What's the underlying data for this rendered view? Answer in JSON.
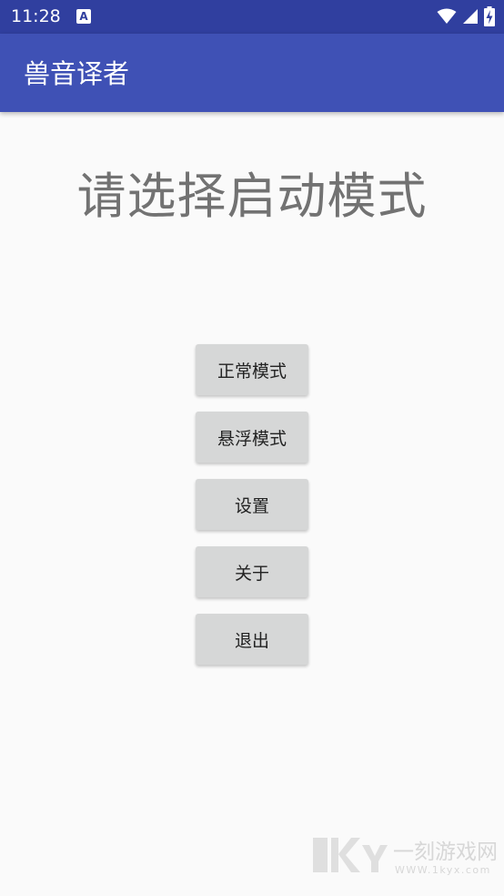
{
  "status_bar": {
    "time": "11:28",
    "notification_icon": "A",
    "icons": [
      "wifi-icon",
      "signal-icon",
      "battery-charging-icon"
    ]
  },
  "app_bar": {
    "title": "兽音译者"
  },
  "main": {
    "prompt": "请选择启动模式",
    "buttons": [
      {
        "label": "正常模式"
      },
      {
        "label": "悬浮模式"
      },
      {
        "label": "设置"
      },
      {
        "label": "关于"
      },
      {
        "label": "退出"
      }
    ]
  },
  "watermark": {
    "logo_text": "1KYX",
    "site_name": "一刻游戏网",
    "url": "WWW.1kyx.com"
  },
  "colors": {
    "status_bar": "#303f9f",
    "app_bar": "#3f51b5",
    "background": "#fafafa",
    "button": "#d6d7d7",
    "prompt_text": "#727272"
  }
}
